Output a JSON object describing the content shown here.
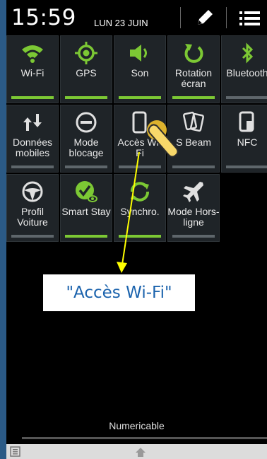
{
  "status": {
    "time": "15:59",
    "date": "LUN 23 JUIN"
  },
  "tiles": [
    {
      "label": "Wi-Fi",
      "icon": "wifi-icon",
      "active": true
    },
    {
      "label": "GPS",
      "icon": "gps-icon",
      "active": true
    },
    {
      "label": "Son",
      "icon": "volume-icon",
      "active": true
    },
    {
      "label": "Rotation écran",
      "icon": "rotation-icon",
      "active": true
    },
    {
      "label": "Bluetooth",
      "icon": "bluetooth-icon",
      "active": false
    },
    {
      "label": "Données mobiles",
      "icon": "mobile-data-icon",
      "active": false
    },
    {
      "label": "Mode blocage",
      "icon": "block-mode-icon",
      "active": false
    },
    {
      "label": "Accès Wi-Fi",
      "icon": "wifi-hotspot-icon",
      "active": false
    },
    {
      "label": "S Beam",
      "icon": "s-beam-icon",
      "active": false
    },
    {
      "label": "NFC",
      "icon": "nfc-icon",
      "active": false
    },
    {
      "label": "Profil Voiture",
      "icon": "car-profile-icon",
      "active": false
    },
    {
      "label": "Smart Stay",
      "icon": "smart-stay-icon",
      "active": true
    },
    {
      "label": "Synchro.",
      "icon": "sync-icon",
      "active": true
    },
    {
      "label": "Mode Hors-ligne",
      "icon": "airplane-icon",
      "active": false
    }
  ],
  "callout": "\"Accès Wi-Fi\"",
  "carrier": "Numericable",
  "colors": {
    "active": "#7cc834",
    "callout_text": "#1b63ad",
    "arrow": "#ffff00"
  }
}
